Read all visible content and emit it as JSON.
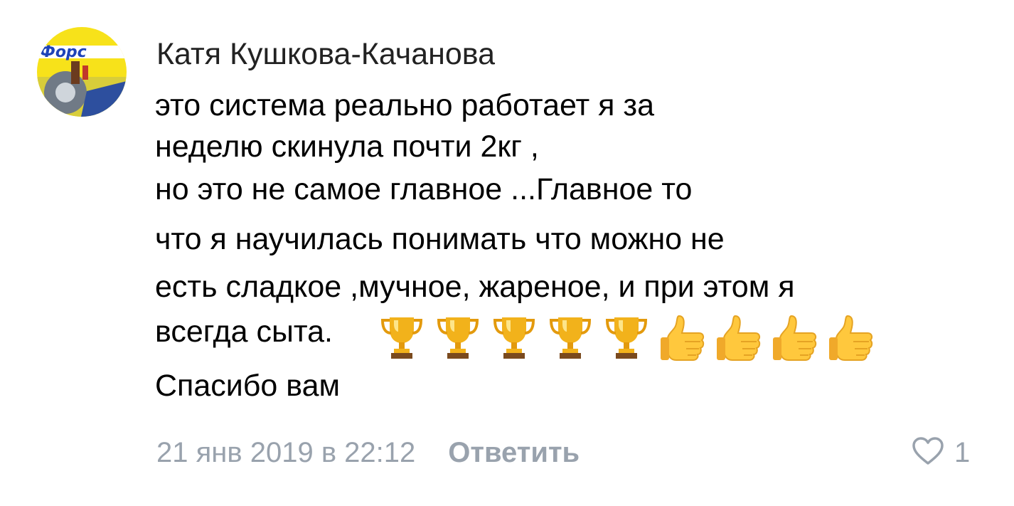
{
  "comment": {
    "author": "Катя Кушкова-Качанова",
    "avatar_text": "Форс",
    "lines": [
      "это система реально работает я за",
      "неделю скинула почти 2кг ,",
      "но это не самое главное ...Главное то",
      "что я научилась понимать что можно не",
      "есть сладкое ,мучное, жареное, и при этом я",
      "всегда сыта.",
      "Спасибо вам"
    ],
    "emojis": [
      "trophy-icon",
      "trophy-icon",
      "trophy-icon",
      "trophy-icon",
      "trophy-icon",
      "thumbs-up-icon",
      "thumbs-up-icon",
      "thumbs-up-icon",
      "thumbs-up-icon"
    ],
    "date": "21 янв 2019 в 22:12",
    "reply_label": "Ответить",
    "likes": "1"
  },
  "colors": {
    "text": "#000000",
    "author": "#222222",
    "muted": "#99a2ad",
    "trophy": "#f2b21b",
    "thumb": "#ffc83d"
  }
}
